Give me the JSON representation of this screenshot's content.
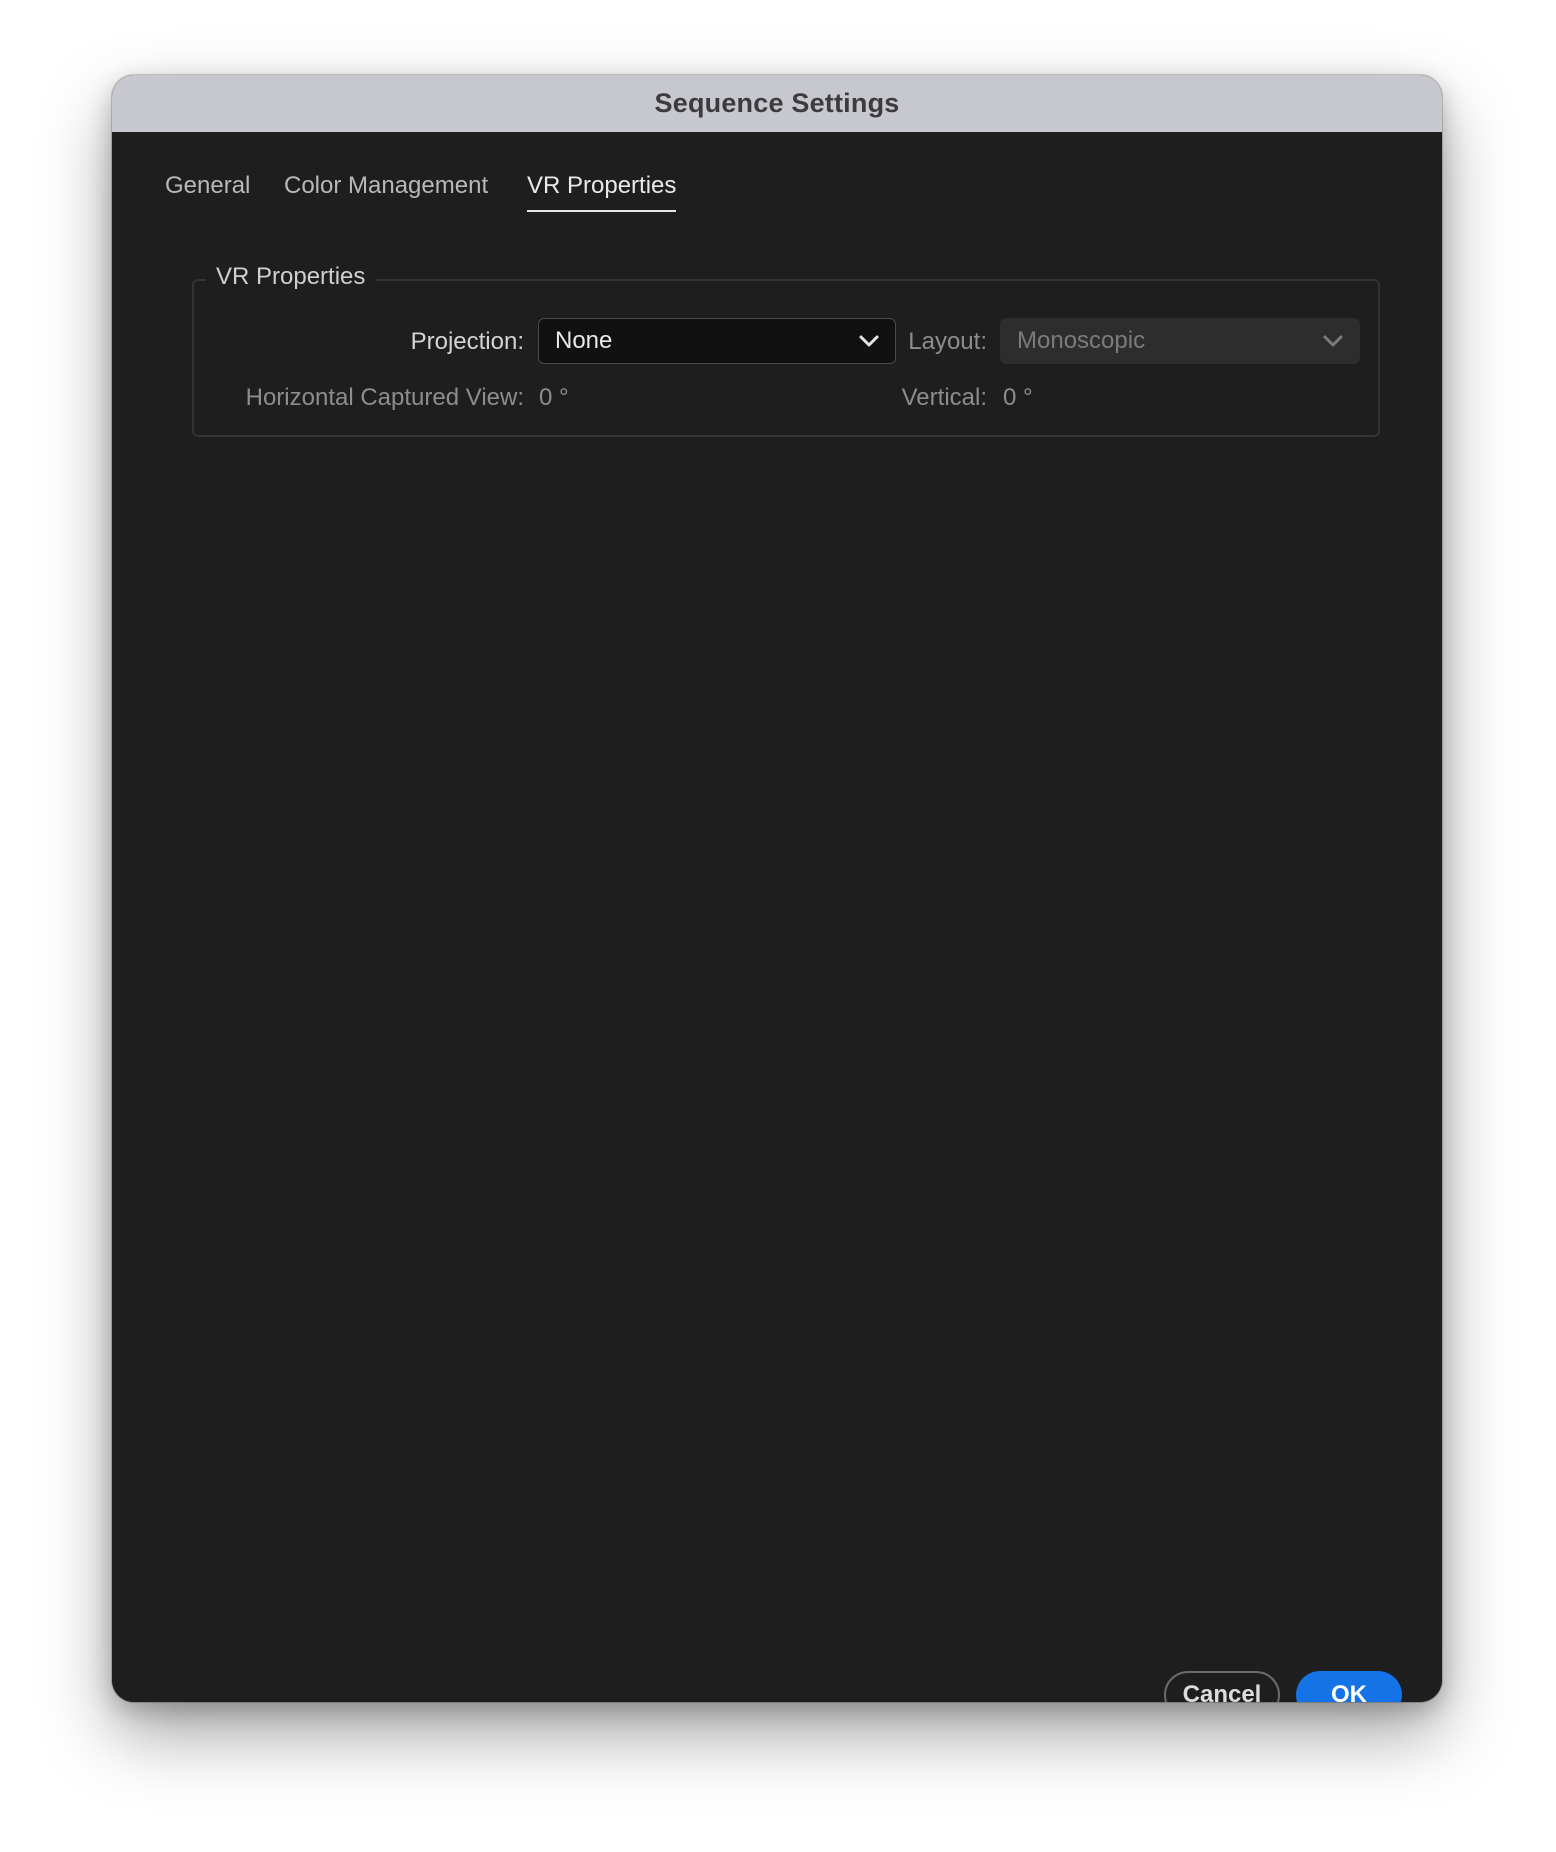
{
  "window": {
    "title": "Sequence Settings"
  },
  "tabs": [
    {
      "label": "General",
      "active": false
    },
    {
      "label": "Color Management",
      "active": false
    },
    {
      "label": "VR Properties",
      "active": true
    }
  ],
  "vr_properties": {
    "group_title": "VR Properties",
    "projection": {
      "label": "Projection:",
      "selected": "None",
      "enabled": true
    },
    "layout": {
      "label": "Layout:",
      "selected": "Monoscopic",
      "enabled": false
    },
    "horizontal_captured_view": {
      "label": "Horizontal Captured View:",
      "value": "0 °"
    },
    "vertical": {
      "label": "Vertical:",
      "value": "0 °"
    }
  },
  "buttons": {
    "cancel_label": "Cancel",
    "ok_label": "OK"
  },
  "icons": {
    "projection_dropdown": "chevron-down-icon",
    "layout_dropdown": "chevron-down-icon"
  },
  "colors": {
    "titlebar": "#c7c7cf",
    "background": "#1e1e1e",
    "accent": "#1473e6"
  }
}
